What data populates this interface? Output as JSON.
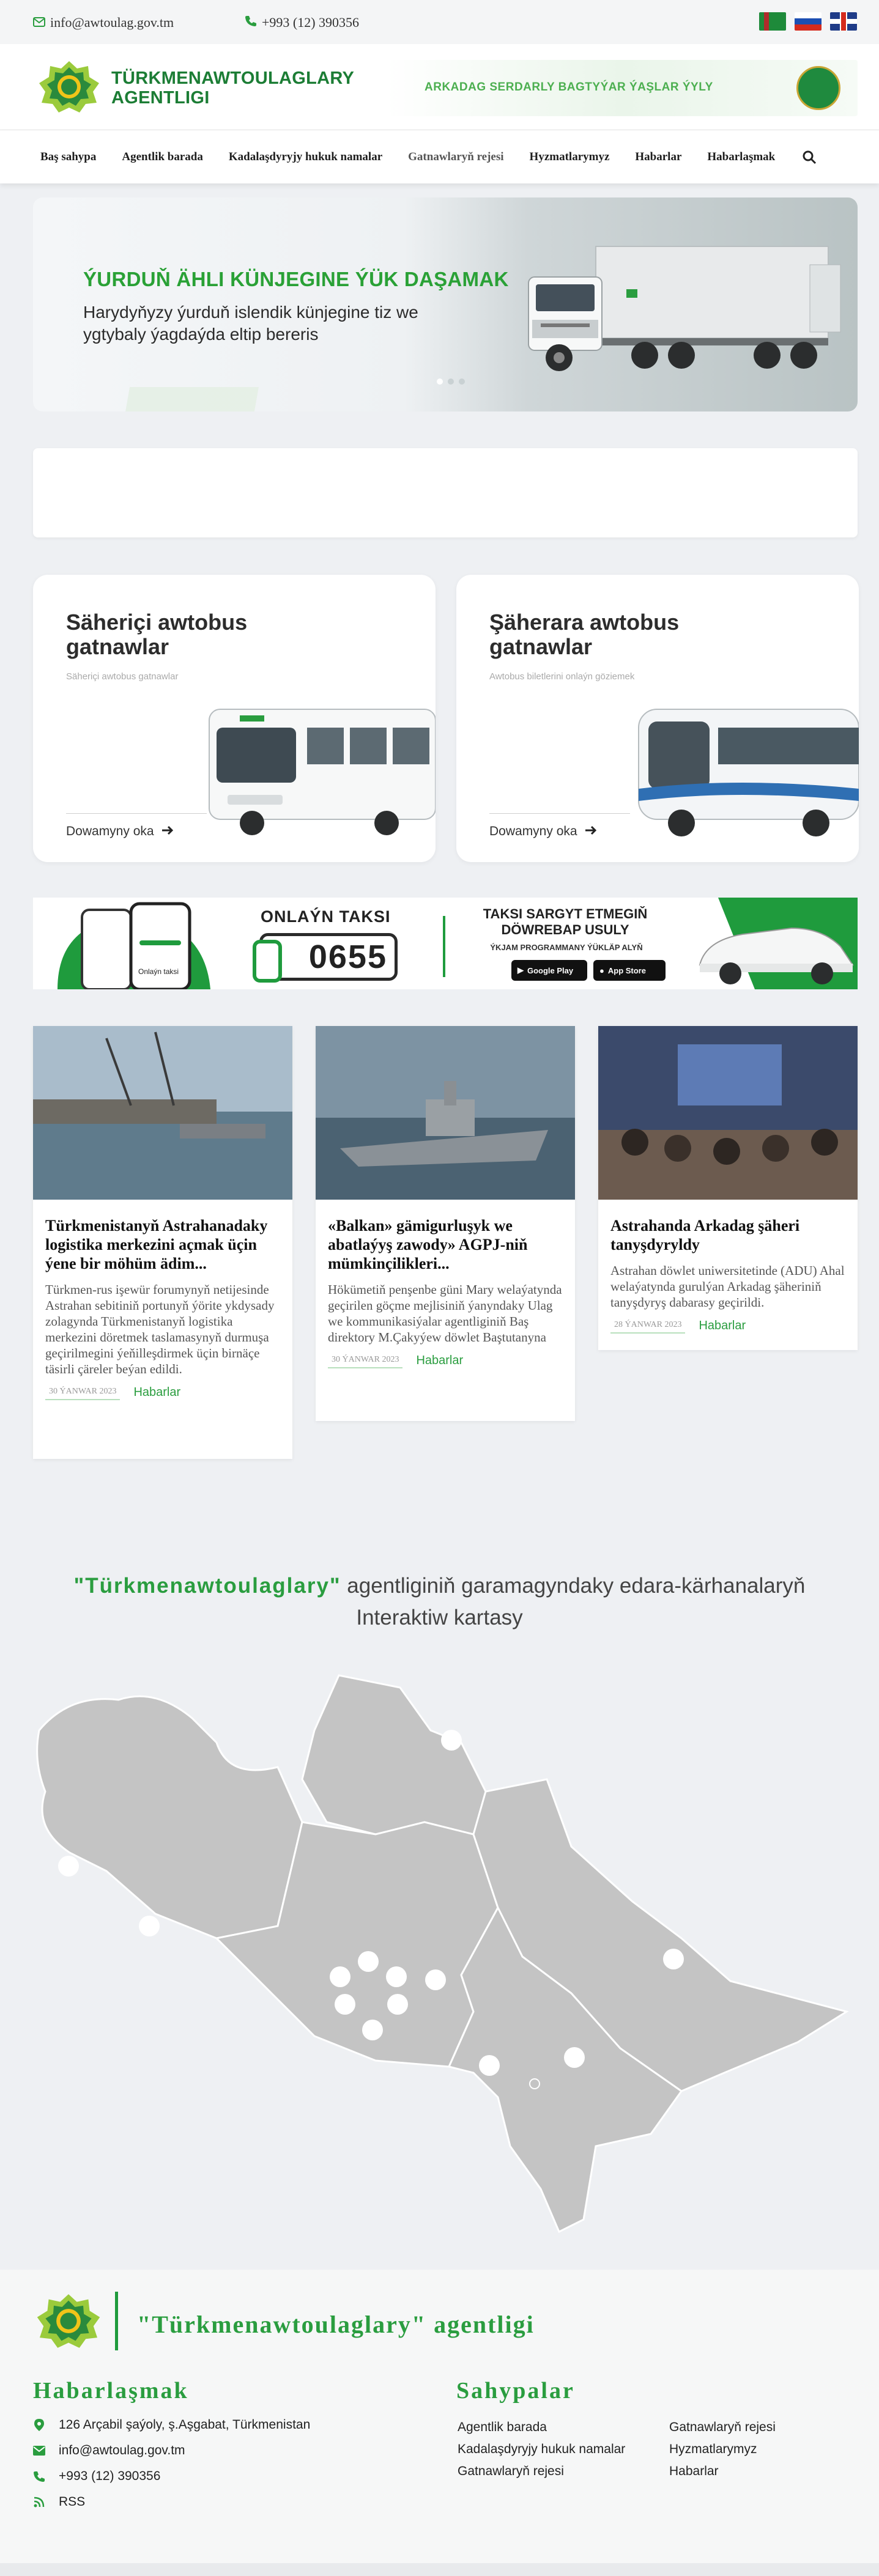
{
  "topbar": {
    "email": "info@awtoulag.gov.tm",
    "phone": "+993 (12) 390356",
    "languages": [
      "tm",
      "ru",
      "en"
    ]
  },
  "header": {
    "brand_line1": "TÜRKMENAWTOULAGLARY",
    "brand_line2": "AGENTLIGI",
    "slogan": "ARKADAG SERDARLY BAGTYÝAR ÝAŞLAR ÝYLY"
  },
  "nav": {
    "items": [
      "Baş sahypa",
      "Agentlik barada",
      "Kadalaşdyryjy hukuk namalar",
      "Gatnawlaryň rejesi",
      "Hyzmatlarymyz",
      "Habarlar",
      "Habarlaşmak"
    ]
  },
  "hero": {
    "headline": "ÝURDUŇ ÄHLI KÜNJEGINE ÝÜK DAŞAMAK",
    "subtext": "Harydyňyzy ýurduň islendik künjegine tiz we ygtybaly ýagdaýda eltip bereris",
    "slides": 3,
    "active_slide": 1
  },
  "bus_cards": [
    {
      "title": "Säheriçi awtobus gatnawlar",
      "subtitle": "Säheriçi awtobus gatnawlar",
      "more": "Dowamyny oka"
    },
    {
      "title": "Şäherara awtobus gatnawlar",
      "subtitle": "Awtobus biletlerini onlaýn göziemek",
      "more": "Dowamyny oka"
    }
  ],
  "taxi": {
    "title": "ONLAÝN TAKSI",
    "number": "0655",
    "order_line1": "TAKSI SARGYT ETMEGIŇ",
    "order_line2": "DÖWREBAP USULY",
    "app_line": "ÝKJAM PROGRAMMANY ÝÜKLÄP ALYŇ",
    "phone_label": "Onlaýn taksi",
    "google_play": "Google Play",
    "app_store": "App Store"
  },
  "news": [
    {
      "title": "Türkmenistanyň Astrahanadaky logistika merkezini açmak üçin ýene bir möhüm ädim...",
      "desc": "Türkmen-rus işewür forumynyň netijesinde Astrahan sebitiniň portunyň ýörite ykdysady zolagynda Türkmenistanyň logistika merkezini döretmek taslamasynyň durmuşa geçirilmegini ýeňilleşdirmek üçin birnäçe täsirli çäreler beýan edildi.",
      "date": "30 ÝANWAR 2023",
      "category": "Habarlar"
    },
    {
      "title": "«Balkan» gämigurluşyk we abatlaýyş zawody» AGPJ-niň mümkinçilikleri...",
      "desc": "Hökümetiň penşenbe güni Mary welaýatynda geçirilen göçme mejlisiniň ýanyndaky Ulag we kommunikasiýalar agentliginiň Baş direktory M.Çakyýew döwlet Baştutanyna",
      "date": "30 ÝANWAR 2023",
      "category": "Habarlar"
    },
    {
      "title": "Astrahanda Arkadag şäheri tanyşdyryldy",
      "desc": "Astrahan döwlet uniwersitetinde (ADU) Ahal welaýatynda gurulýan Arkadag şäheriniň tanyşdyryş dabarasy geçirildi.",
      "date": "28 ÝANWAR 2023",
      "category": "Habarlar"
    }
  ],
  "map_section": {
    "title_highlight": "\"Türkmenawtoulaglary\"",
    "title_rest": "agentliginiň garamagyndaky edara-kärhanalaryň",
    "title_line2": "Interaktiw kartasy"
  },
  "footer": {
    "org_name": "\"Türkmenawtoulaglary\" agentligi",
    "contact_heading": "Habarlaşmak",
    "pages_heading": "Sahypalar",
    "address": "126 Arçabil şaýoly, ş.Aşgabat, Türkmenistan",
    "email": "info@awtoulag.gov.tm",
    "phone": "+993 (12) 390356",
    "rss": "RSS",
    "pages_col1": [
      "Agentlik barada",
      "Kadalaşdyryjy hukuk namalar",
      "Gatnawlaryň rejesi"
    ],
    "pages_col2": [
      "Gatnawlaryň rejesi",
      "Hyzmatlarymyz",
      "Habarlar"
    ]
  },
  "colors": {
    "brand_green": "#2a9d3f",
    "background": "#eef0f3"
  }
}
